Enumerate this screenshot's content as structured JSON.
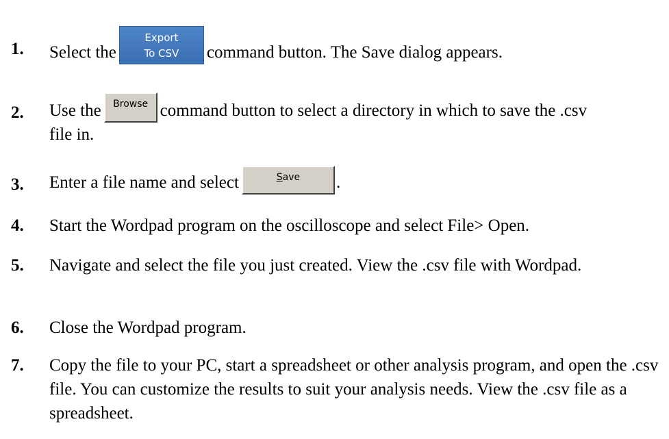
{
  "steps": [
    {
      "number": "1.",
      "before": "Select the",
      "button": {
        "line1": "Export",
        "line2": "To CSV"
      },
      "after": "command button. The Save dialog appears."
    },
    {
      "number": "2.",
      "before": "Use the",
      "button": {
        "label": "Browse"
      },
      "after": "command button to select a directory in which to save the .csv file in."
    },
    {
      "number": "3.",
      "before": "Enter a file name and select",
      "button": {
        "accel": "S",
        "rest": "ave"
      },
      "after": "."
    },
    {
      "number": "4.",
      "text": "Start the Wordpad program on the oscilloscope and select File> Open."
    },
    {
      "number": "5.",
      "text": "Navigate and select the file you just created. View the .csv file with Wordpad."
    },
    {
      "number": "6.",
      "text": "Close the Wordpad program."
    },
    {
      "number": "7.",
      "text": "Copy the file to your PC, start a spreadsheet or other analysis program, and open the .csv file. You can customize the results to suit your analysis needs. View the .csv file as a spreadsheet."
    }
  ]
}
